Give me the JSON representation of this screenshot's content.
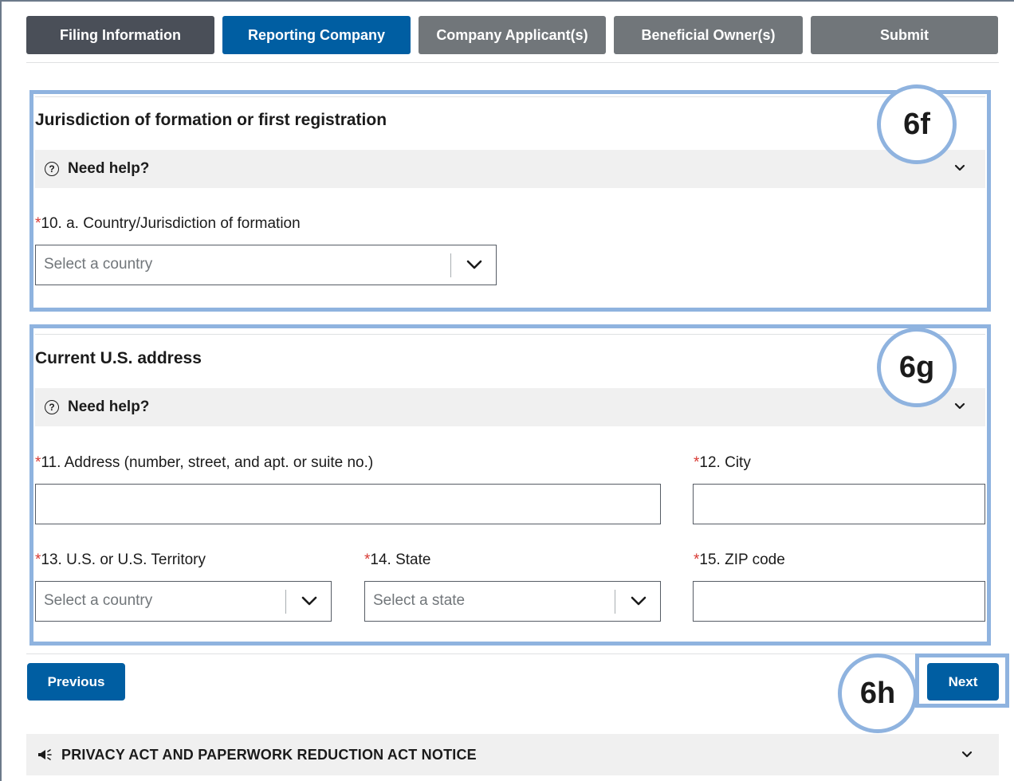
{
  "tabs": [
    {
      "label": "Filing Information",
      "state": "completed"
    },
    {
      "label": "Reporting Company",
      "state": "active"
    },
    {
      "label": "Company Applicant(s)",
      "state": "inactive"
    },
    {
      "label": "Beneficial Owner(s)",
      "state": "inactive"
    },
    {
      "label": "Submit",
      "state": "inactive"
    }
  ],
  "callouts": {
    "jurisdiction": "6f",
    "address": "6g",
    "next": "6h"
  },
  "jurisdiction": {
    "title": "Jurisdiction of formation or first registration",
    "help": "Need help?",
    "country_field": {
      "required_mark": "*",
      "label": "10. a. Country/Jurisdiction of formation",
      "placeholder": "Select a country"
    }
  },
  "address": {
    "title": "Current U.S. address",
    "help": "Need help?",
    "street": {
      "required_mark": "*",
      "label": "11. Address (number, street, and apt. or suite no.)",
      "value": ""
    },
    "city": {
      "required_mark": "*",
      "label": "12. City",
      "value": ""
    },
    "territory": {
      "required_mark": "*",
      "label": "13. U.S. or U.S. Territory",
      "placeholder": "Select a country"
    },
    "state": {
      "required_mark": "*",
      "label": "14. State",
      "placeholder": "Select a state"
    },
    "zip": {
      "required_mark": "*",
      "label": "15. ZIP code",
      "value": ""
    }
  },
  "nav": {
    "previous": "Previous",
    "next": "Next"
  },
  "privacy": {
    "label": "PRIVACY ACT AND PAPERWORK REDUCTION ACT NOTICE"
  },
  "colors": {
    "primary": "#005ea2",
    "tab_completed": "#4a4f58",
    "tab_inactive": "#71767a",
    "required": "#d83933",
    "highlight": "#8fb3df"
  }
}
